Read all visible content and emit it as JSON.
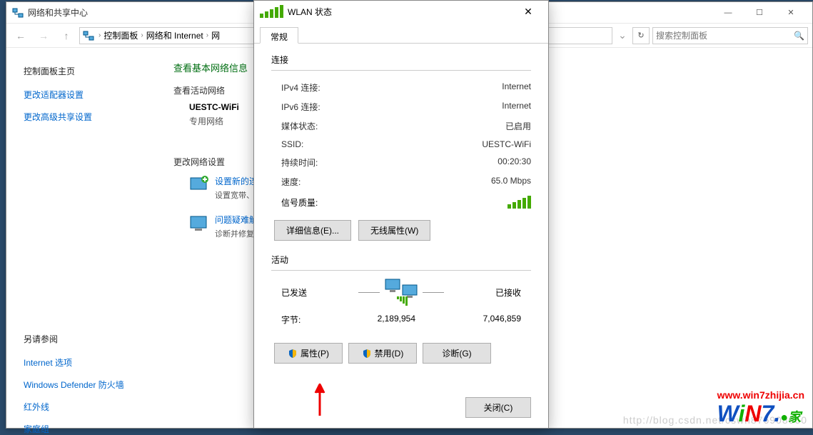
{
  "window": {
    "title": "网络和共享中心",
    "min": "—",
    "max": "☐",
    "close": "✕"
  },
  "nav": {
    "breadcrumb": [
      "控制面板",
      "网络和 Internet",
      "网"
    ],
    "refresh": "↻",
    "search_placeholder": "搜索控制面板"
  },
  "sidebar": {
    "header": "控制面板主页",
    "links": [
      "更改适配器设置",
      "更改高级共享设置"
    ],
    "see_also_header": "另请参阅",
    "see_also": [
      "Internet 选项",
      "Windows Defender 防火墙",
      "红外线",
      "家庭组"
    ]
  },
  "content": {
    "heading": "查看基本网络信息",
    "active_label": "查看活动网络",
    "network_name": "UESTC-WiFi",
    "network_type": "专用网络",
    "change_label": "更改网络设置",
    "items": [
      {
        "title": "设置新的连接",
        "desc": "设置宽带、"
      },
      {
        "title": "问题疑难解答",
        "desc": "诊断并修复网"
      }
    ]
  },
  "dialog": {
    "title": "WLAN 状态",
    "tab": "常规",
    "section_conn": "连接",
    "fields": {
      "ipv4_label": "IPv4 连接:",
      "ipv4_val": "Internet",
      "ipv6_label": "IPv6 连接:",
      "ipv6_val": "Internet",
      "media_label": "媒体状态:",
      "media_val": "已启用",
      "ssid_label": "SSID:",
      "ssid_val": "UESTC-WiFi",
      "dur_label": "持续时间:",
      "dur_val": "00:20:30",
      "speed_label": "速度:",
      "speed_val": "65.0 Mbps",
      "sig_label": "信号质量:"
    },
    "btn_details": "详细信息(E)...",
    "btn_wireless": "无线属性(W)",
    "section_activity": "活动",
    "sent_label": "已发送",
    "recv_label": "已接收",
    "bytes_label": "字节:",
    "bytes_sent": "2,189,954",
    "bytes_recv": "7,046,859",
    "btn_props": "属性(P)",
    "btn_disable": "禁用(D)",
    "btn_diag": "诊断(G)",
    "btn_close": "关闭(C)"
  },
  "watermark": {
    "url": "www.win7zhijia.cn",
    "bg_url": "http://blog.csdn.net/cswh876908060"
  }
}
